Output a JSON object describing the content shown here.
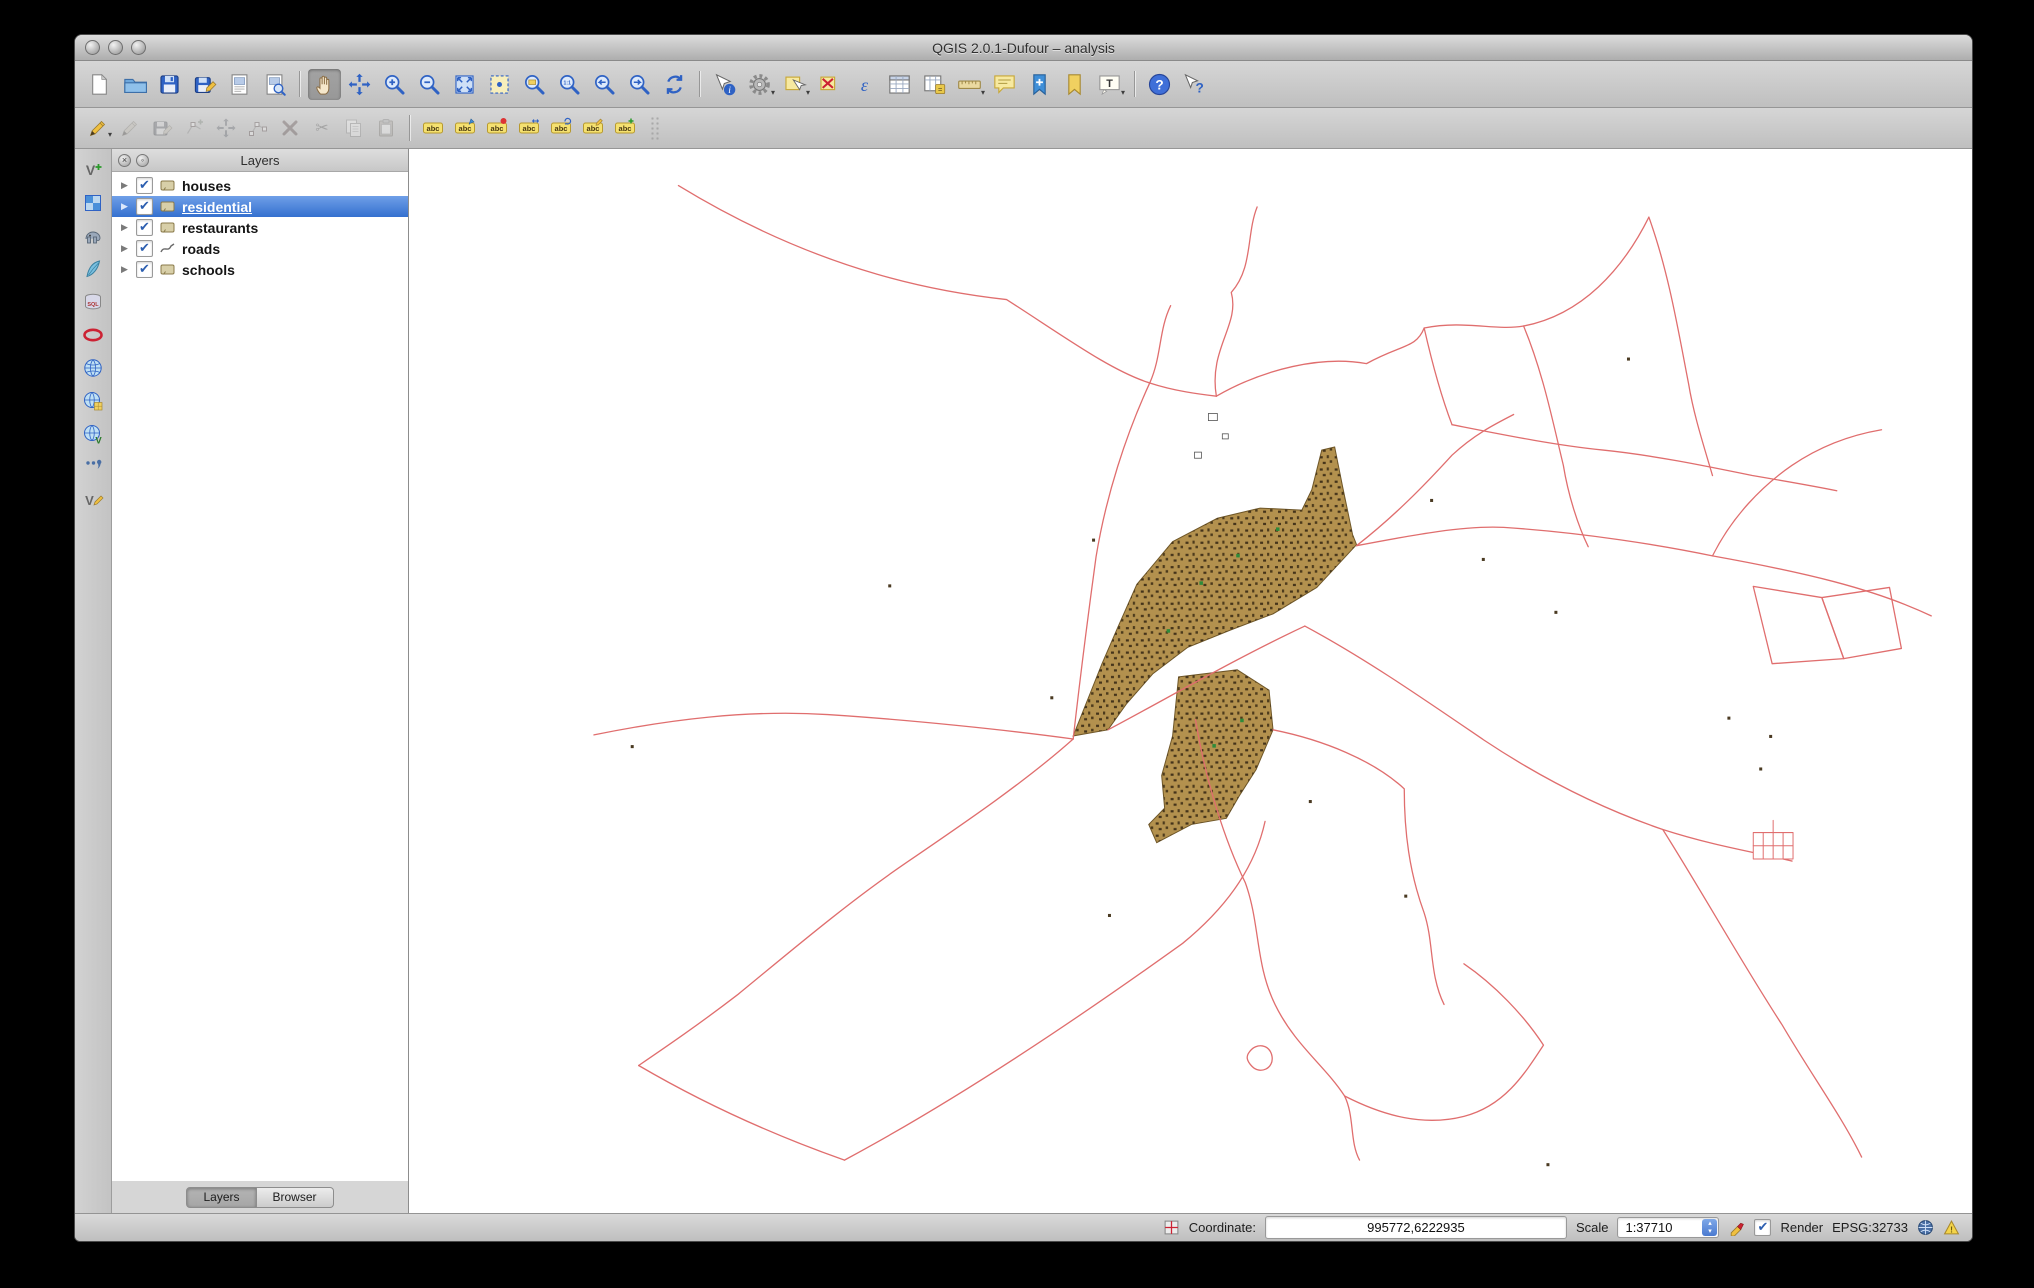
{
  "window": {
    "title": "QGIS 2.0.1-Dufour – analysis"
  },
  "titlebar": {
    "buttons": [
      {
        "name": "close-button"
      },
      {
        "name": "minimize-button"
      },
      {
        "name": "zoom-button"
      }
    ]
  },
  "toolbar_main": {
    "items": [
      {
        "name": "new-project",
        "shape": "page"
      },
      {
        "name": "open-project",
        "shape": "folder"
      },
      {
        "name": "save-project",
        "shape": "disk"
      },
      {
        "name": "save-project-as",
        "shape": "disk-pencil"
      },
      {
        "name": "new-print-composer",
        "shape": "composer"
      },
      {
        "name": "composer-manager",
        "shape": "composer-mag"
      },
      {
        "separator": true
      },
      {
        "name": "touch-zoom-pan",
        "shape": "hand",
        "pressed": true
      },
      {
        "name": "pan-map-to-selection",
        "shape": "move"
      },
      {
        "name": "zoom-in",
        "shape": "mag-plus"
      },
      {
        "name": "zoom-out",
        "shape": "mag-minus"
      },
      {
        "name": "zoom-full-extent",
        "shape": "bluebox-arrows"
      },
      {
        "name": "zoom-to-selection",
        "shape": "bluebox-dashed"
      },
      {
        "name": "zoom-to-layer",
        "shape": "mag-layer"
      },
      {
        "name": "zoom-native-resolution",
        "shape": "mag-11"
      },
      {
        "name": "zoom-last",
        "shape": "mag-left"
      },
      {
        "name": "zoom-next",
        "shape": "mag-right"
      },
      {
        "name": "refresh-map",
        "shape": "refresh"
      },
      {
        "separator": true
      },
      {
        "name": "identify-features",
        "shape": "identify"
      },
      {
        "name": "run-feature-action",
        "shape": "gear",
        "dropdown": true
      },
      {
        "name": "select-features",
        "shape": "select",
        "dropdown": true
      },
      {
        "name": "deselect-features",
        "shape": "deselect"
      },
      {
        "name": "select-by-expression",
        "shape": "epsilon"
      },
      {
        "name": "open-attribute-table",
        "shape": "table"
      },
      {
        "name": "field-calculator",
        "shape": "calc"
      },
      {
        "name": "measure",
        "shape": "ruler",
        "dropdown": true
      },
      {
        "name": "map-tips",
        "shape": "bubble"
      },
      {
        "name": "new-bookmark",
        "shape": "bookmark-plus"
      },
      {
        "name": "show-bookmarks",
        "shape": "bookmark"
      },
      {
        "name": "text-annotation",
        "shape": "annotation",
        "dropdown": true
      },
      {
        "separator": true
      },
      {
        "name": "help-contents",
        "shape": "help"
      },
      {
        "name": "whats-this",
        "shape": "whatsthis"
      }
    ]
  },
  "toolbar_edit": {
    "items": [
      {
        "name": "current-edits",
        "shape": "pencil",
        "dropdown": true
      },
      {
        "name": "toggle-editing",
        "shape": "pencil",
        "disabled": true
      },
      {
        "name": "save-layer-edits",
        "shape": "disk-pencil",
        "disabled": true
      },
      {
        "name": "add-feature",
        "shape": "node-plus",
        "disabled": true
      },
      {
        "name": "move-feature",
        "shape": "move",
        "disabled": true
      },
      {
        "name": "node-tool",
        "shape": "node",
        "disabled": true
      },
      {
        "name": "delete-selected",
        "shape": "redx",
        "disabled": true
      },
      {
        "name": "cut-features",
        "shape": "scissors",
        "disabled": true
      },
      {
        "name": "copy-features",
        "shape": "copy",
        "disabled": true
      },
      {
        "name": "paste-features",
        "shape": "paste",
        "disabled": true
      },
      {
        "separator": true
      },
      {
        "name": "labeling",
        "shape": "abc"
      },
      {
        "name": "label-pin",
        "shape": "abc-pin"
      },
      {
        "name": "label-highlight",
        "shape": "abc-red"
      },
      {
        "name": "label-move",
        "shape": "abc-move"
      },
      {
        "name": "label-rotate",
        "shape": "abc-rot"
      },
      {
        "name": "label-properties",
        "shape": "abc-edit"
      },
      {
        "name": "label-add",
        "shape": "abc-plus"
      },
      {
        "grip": true
      }
    ]
  },
  "toolbar_layers": {
    "items": [
      {
        "name": "add-vector-layer",
        "shape": "vplus"
      },
      {
        "name": "add-raster-layer",
        "shape": "checker"
      },
      {
        "name": "add-postgis-layer",
        "shape": "elephant"
      },
      {
        "name": "add-spatialite-layer",
        "shape": "feather"
      },
      {
        "name": "add-mssql-layer",
        "shape": "mssql"
      },
      {
        "name": "add-oracle-layer",
        "shape": "oracle"
      },
      {
        "name": "add-wms-layer",
        "shape": "globe"
      },
      {
        "name": "add-wcs-layer",
        "shape": "globe-grid"
      },
      {
        "name": "add-wfs-layer",
        "shape": "globe-v"
      },
      {
        "name": "add-delimited-text-layer",
        "shape": "comma"
      },
      {
        "name": "new-shapefile-layer",
        "shape": "vpencil"
      }
    ]
  },
  "layers_panel": {
    "title": "Layers",
    "layers": [
      {
        "label": "houses",
        "checked": true,
        "selected": false,
        "type": "polygon"
      },
      {
        "label": "residential",
        "checked": true,
        "selected": true,
        "type": "polygon"
      },
      {
        "label": "restaurants",
        "checked": true,
        "selected": false,
        "type": "polygon"
      },
      {
        "label": "roads",
        "checked": true,
        "selected": false,
        "type": "line"
      },
      {
        "label": "schools",
        "checked": true,
        "selected": false,
        "type": "polygon"
      }
    ],
    "tabs": [
      {
        "label": "Layers",
        "active": true
      },
      {
        "label": "Browser",
        "active": false
      }
    ]
  },
  "status_bar": {
    "coordinate_label": "Coordinate:",
    "coordinate_value": "995772,6222935",
    "scale_label": "Scale",
    "scale_value": "1:37710",
    "render_label": "Render",
    "render_checked": true,
    "crs_label": "EPSG:32733"
  },
  "map": {
    "colors": {
      "roads": "#e06e6e",
      "residential_fill": "#b3914e",
      "residential_stroke": "#6f5728",
      "selection": "#3470cf"
    }
  }
}
